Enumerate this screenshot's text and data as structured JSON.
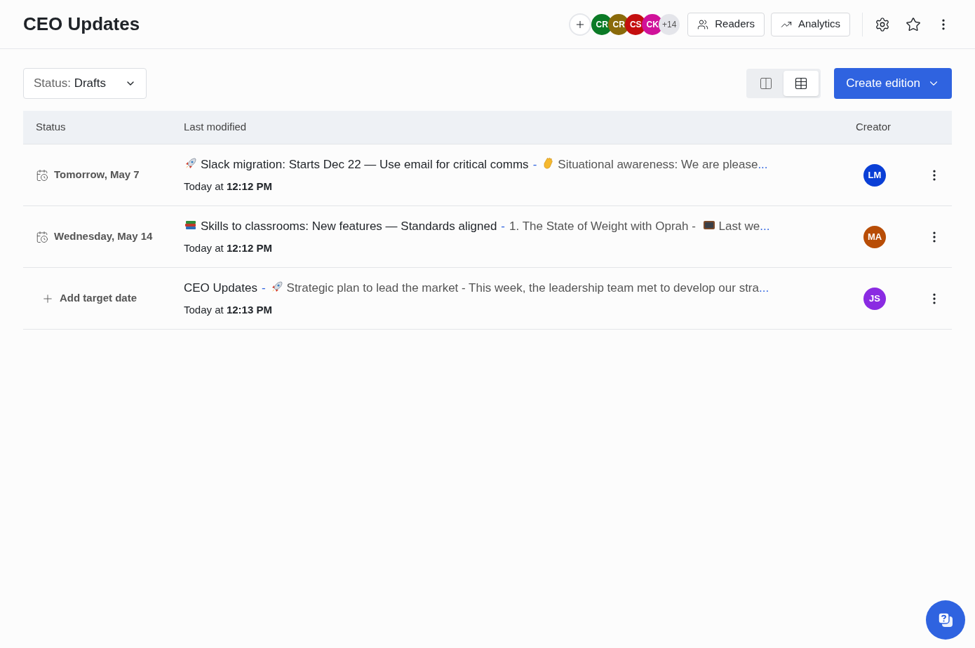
{
  "header": {
    "title": "CEO Updates",
    "avatars": [
      {
        "initials": "CR",
        "color": "#0b7a26"
      },
      {
        "initials": "CR",
        "color": "#8a6a0a"
      },
      {
        "initials": "CS",
        "color": "#c40f0f"
      },
      {
        "initials": "CK",
        "color": "#d0129a"
      }
    ],
    "more_count": "+14",
    "buttons": [
      {
        "kind": "readers",
        "label": "Readers"
      },
      {
        "kind": "analytics",
        "label": "Analytics"
      }
    ]
  },
  "toolbar": {
    "filter": {
      "label": "Status:",
      "value": "Drafts"
    },
    "views": [
      {
        "kind": "board",
        "selected": false
      },
      {
        "kind": "table",
        "selected": true
      }
    ],
    "create_button": "Create edition"
  },
  "table": {
    "columns": [
      "Status",
      "Last modified",
      "Creator"
    ],
    "rows": [
      {
        "kind": "date",
        "status": "Tomorrow, May 7",
        "summary": [
          {
            "kind": "rocket"
          },
          {
            "kind": "title",
            "text": "Slack migration: Starts Dec 22 — Use email for critical comms"
          },
          {
            "kind": "separator",
            "text": "-"
          },
          {
            "kind": "hand"
          },
          {
            "kind": "preview",
            "text": "Situational awareness: We are please"
          },
          {
            "kind": "more",
            "text": "..."
          }
        ],
        "modified": "Today at",
        "time": "12:12 PM",
        "creator": {
          "initials": "LM",
          "color": "#0a3fd6"
        }
      },
      {
        "kind": "date",
        "status": "Wednesday, May 14",
        "summary": [
          {
            "kind": "books"
          },
          {
            "kind": "title",
            "text": "Skills to classrooms: New features — Standards aligned"
          },
          {
            "kind": "separator",
            "text": "-"
          },
          {
            "kind": "preview",
            "text": "1. The State of Weight with Oprah -"
          },
          {
            "kind": "tv"
          },
          {
            "kind": "preview",
            "text": "Last we"
          },
          {
            "kind": "more",
            "text": "..."
          }
        ],
        "modified": "Today at",
        "time": "12:12 PM",
        "creator": {
          "initials": "MA",
          "color": "#b84d06"
        }
      },
      {
        "kind": "add",
        "status": "Add target date",
        "summary": [
          {
            "kind": "title",
            "text": "CEO Updates"
          },
          {
            "kind": "separator",
            "text": "-"
          },
          {
            "kind": "rocket"
          },
          {
            "kind": "preview",
            "text": "Strategic plan to lead the market - This week, the leadership team met to develop our stra"
          },
          {
            "kind": "more",
            "text": "..."
          }
        ],
        "modified": "Today at",
        "time": "12:13 PM",
        "creator": {
          "initials": "JS",
          "color": "#8a2be2"
        }
      }
    ]
  }
}
